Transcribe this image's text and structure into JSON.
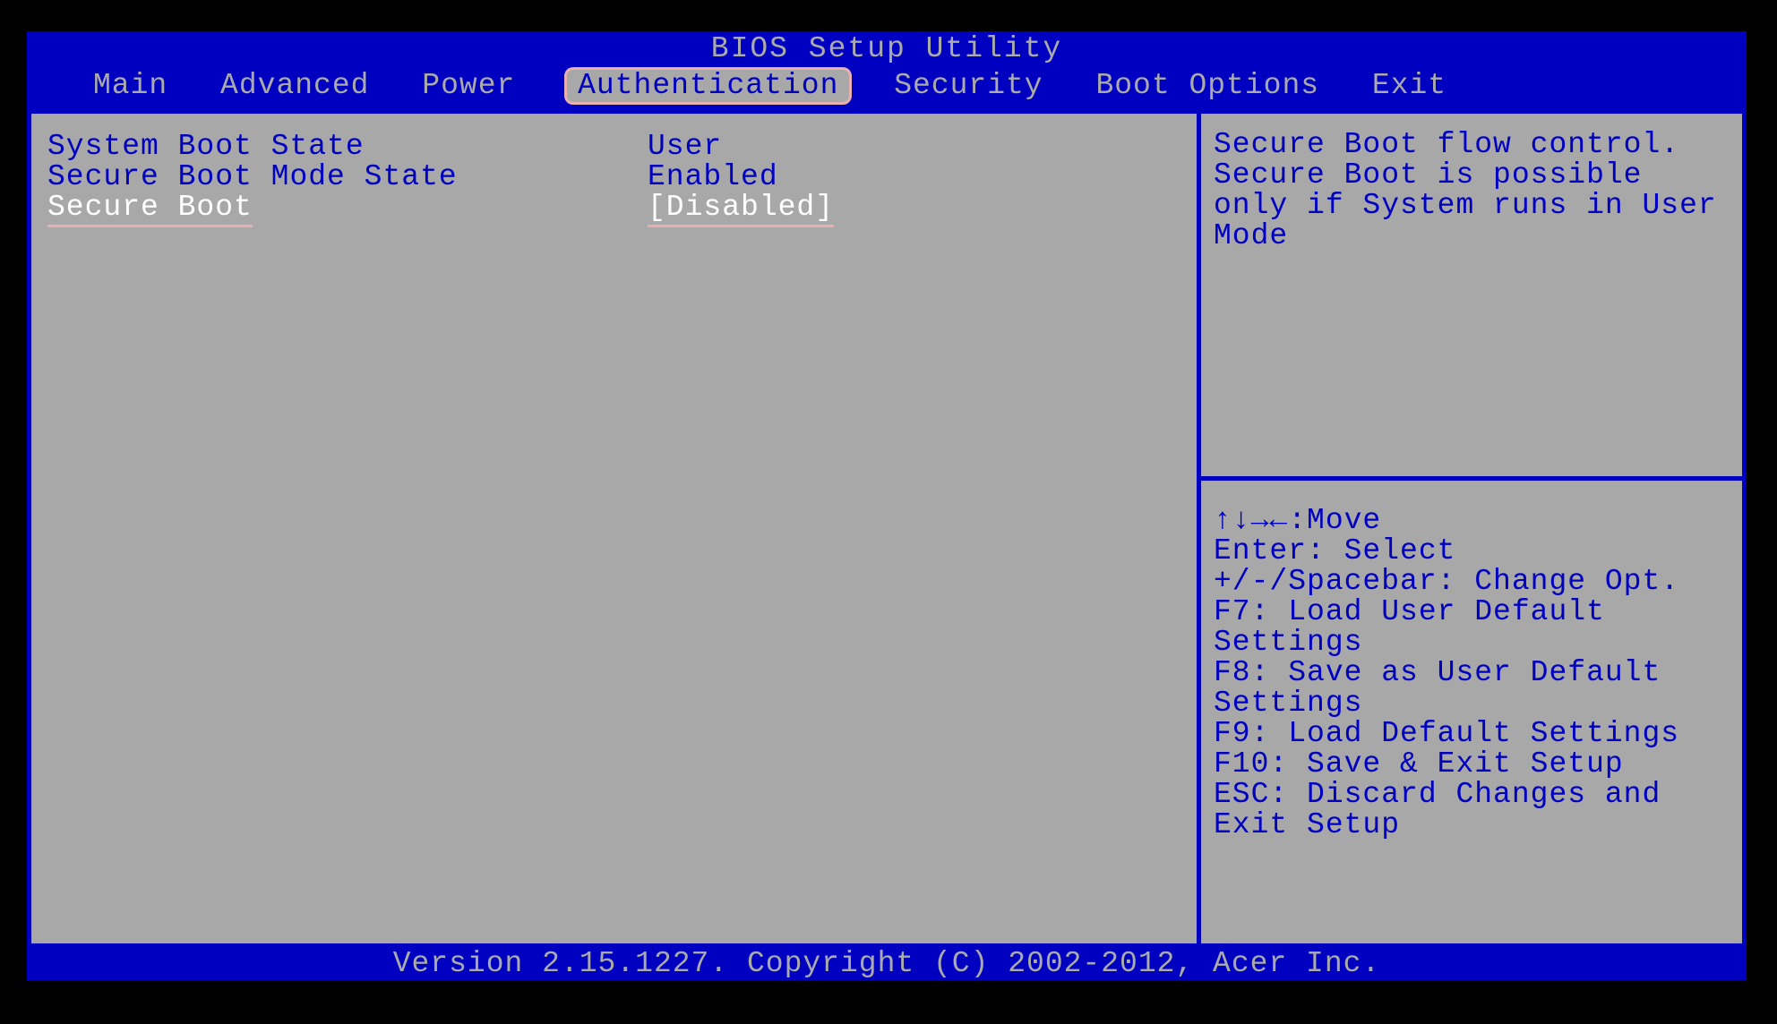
{
  "title": "BIOS Setup Utility",
  "tabs": [
    {
      "label": "Main"
    },
    {
      "label": "Advanced"
    },
    {
      "label": "Power"
    },
    {
      "label": "Authentication"
    },
    {
      "label": "Security"
    },
    {
      "label": "Boot Options"
    },
    {
      "label": "Exit"
    }
  ],
  "active_tab_index": 3,
  "rows": [
    {
      "label": "System Boot State",
      "value": "User"
    },
    {
      "label": "Secure Boot Mode State",
      "value": "Enabled"
    },
    {
      "label": "Secure Boot",
      "value": "[Disabled]"
    }
  ],
  "selected_row_index": 2,
  "help_text": "Secure Boot flow control. Secure Boot is possible only if System runs in User Mode",
  "hints": {
    "move_icon": "↑↓→←",
    "move": ":Move",
    "enter": "Enter: Select",
    "change": "+/-/Spacebar: Change Opt.",
    "f7": "F7: Load User Default Settings",
    "f8": "F8: Save as User Default Settings",
    "f9": "F9: Load Default Settings",
    "f10": "F10: Save & Exit Setup",
    "esc": "ESC: Discard Changes and Exit Setup"
  },
  "footer": "Version 2.15.1227. Copyright (C) 2002-2012, Acer Inc."
}
